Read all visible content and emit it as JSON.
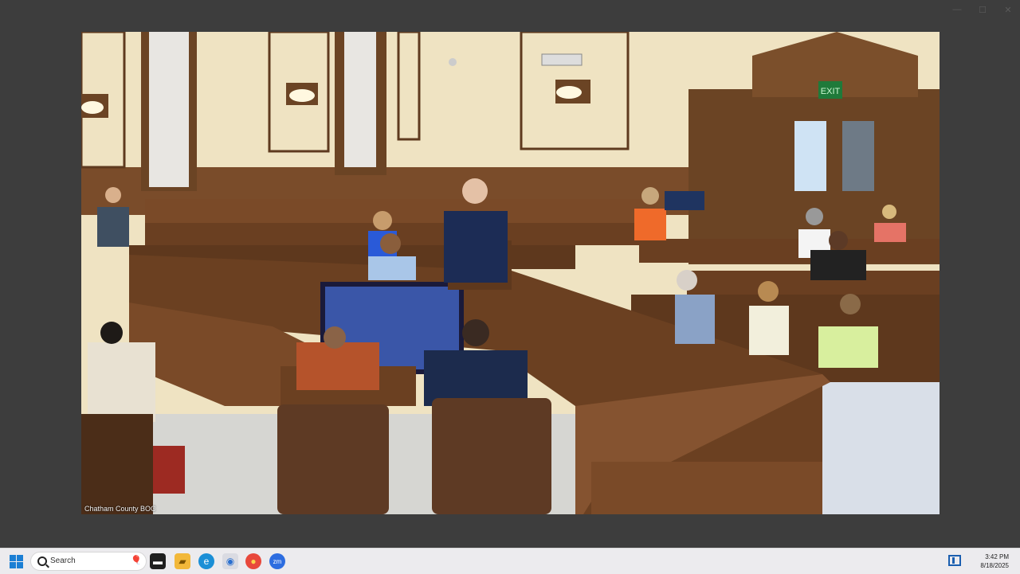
{
  "window": {
    "minimize_glyph": "—",
    "maximize_glyph": "☐",
    "close_glyph": "✕"
  },
  "video": {
    "caption": "Chatham County BOC",
    "exit_sign": "EXIT"
  },
  "taskbar": {
    "search_label": "Search",
    "search_decoration": "🎈",
    "apps": [
      {
        "name": "file-explorer-icon",
        "glyph": "▬"
      },
      {
        "name": "folder-icon",
        "glyph": "▰"
      },
      {
        "name": "edge-icon",
        "glyph": "e"
      },
      {
        "name": "active-app-icon",
        "glyph": "◉"
      },
      {
        "name": "chrome-icon",
        "glyph": "●"
      },
      {
        "name": "zoom-icon",
        "glyph": "zm"
      }
    ],
    "clock": {
      "time": "3:42 PM",
      "date": "8/18/2025"
    }
  },
  "colors": {
    "taskbar": "#ecebee",
    "start_blue": "#1b7fd4",
    "wood": "#6b4424",
    "wall": "#efe3c2"
  }
}
